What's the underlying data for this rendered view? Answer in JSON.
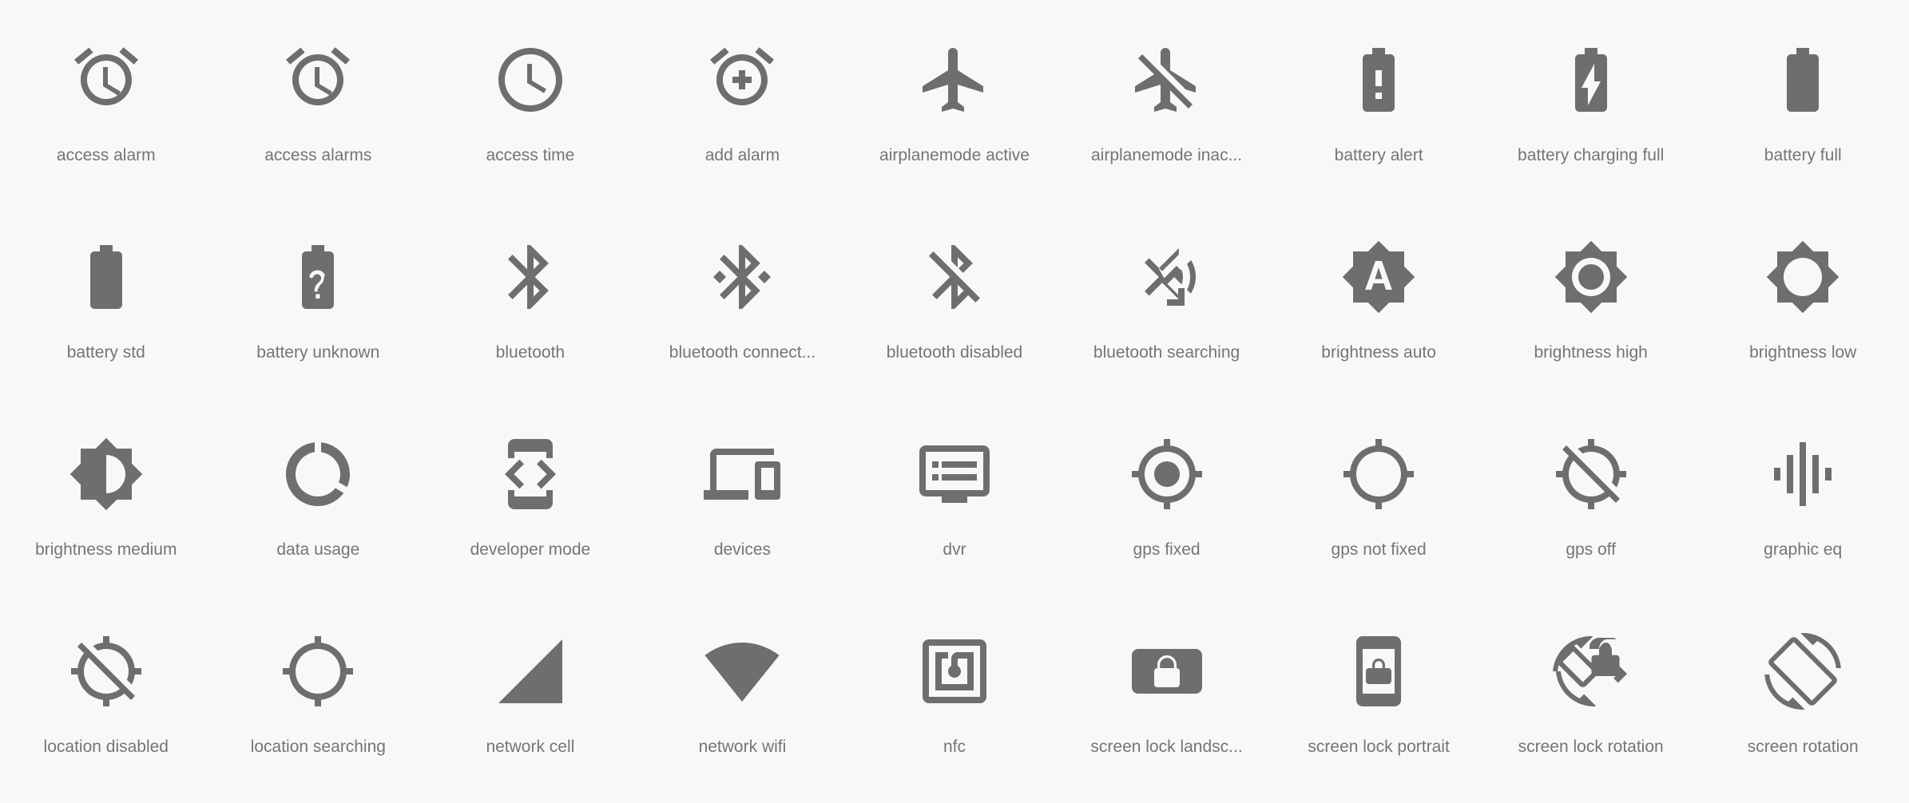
{
  "gallery": {
    "background_color": "#f8f8f8",
    "icon_color": "#6e6e6e",
    "label_color": "#757575",
    "columns": 9,
    "rows": 4,
    "icons": [
      {
        "label": "access alarm",
        "icon_name": "access-alarm-icon"
      },
      {
        "label": "access alarms",
        "icon_name": "access-alarms-icon"
      },
      {
        "label": "access time",
        "icon_name": "access-time-icon"
      },
      {
        "label": "add alarm",
        "icon_name": "add-alarm-icon"
      },
      {
        "label": "airplanemode active",
        "icon_name": "airplanemode-active-icon"
      },
      {
        "label": "airplanemode inac...",
        "icon_name": "airplanemode-inactive-icon"
      },
      {
        "label": "battery alert",
        "icon_name": "battery-alert-icon"
      },
      {
        "label": "battery charging full",
        "icon_name": "battery-charging-full-icon"
      },
      {
        "label": "battery full",
        "icon_name": "battery-full-icon"
      },
      {
        "label": "battery std",
        "icon_name": "battery-std-icon"
      },
      {
        "label": "battery unknown",
        "icon_name": "battery-unknown-icon"
      },
      {
        "label": "bluetooth",
        "icon_name": "bluetooth-icon"
      },
      {
        "label": "bluetooth connect...",
        "icon_name": "bluetooth-connected-icon"
      },
      {
        "label": "bluetooth disabled",
        "icon_name": "bluetooth-disabled-icon"
      },
      {
        "label": "bluetooth searching",
        "icon_name": "bluetooth-searching-icon"
      },
      {
        "label": "brightness auto",
        "icon_name": "brightness-auto-icon"
      },
      {
        "label": "brightness high",
        "icon_name": "brightness-high-icon"
      },
      {
        "label": "brightness low",
        "icon_name": "brightness-low-icon"
      },
      {
        "label": "brightness medium",
        "icon_name": "brightness-medium-icon"
      },
      {
        "label": "data usage",
        "icon_name": "data-usage-icon"
      },
      {
        "label": "developer mode",
        "icon_name": "developer-mode-icon"
      },
      {
        "label": "devices",
        "icon_name": "devices-icon"
      },
      {
        "label": "dvr",
        "icon_name": "dvr-icon"
      },
      {
        "label": "gps fixed",
        "icon_name": "gps-fixed-icon"
      },
      {
        "label": "gps not fixed",
        "icon_name": "gps-not-fixed-icon"
      },
      {
        "label": "gps off",
        "icon_name": "gps-off-icon"
      },
      {
        "label": "graphic eq",
        "icon_name": "graphic-eq-icon"
      },
      {
        "label": "location disabled",
        "icon_name": "location-disabled-icon"
      },
      {
        "label": "location searching",
        "icon_name": "location-searching-icon"
      },
      {
        "label": "network cell",
        "icon_name": "network-cell-icon"
      },
      {
        "label": "network wifi",
        "icon_name": "network-wifi-icon"
      },
      {
        "label": "nfc",
        "icon_name": "nfc-icon"
      },
      {
        "label": "screen lock landsc...",
        "icon_name": "screen-lock-landscape-icon"
      },
      {
        "label": "screen lock portrait",
        "icon_name": "screen-lock-portrait-icon"
      },
      {
        "label": "screen lock rotation",
        "icon_name": "screen-lock-rotation-icon"
      },
      {
        "label": "screen rotation",
        "icon_name": "screen-rotation-icon"
      }
    ]
  }
}
